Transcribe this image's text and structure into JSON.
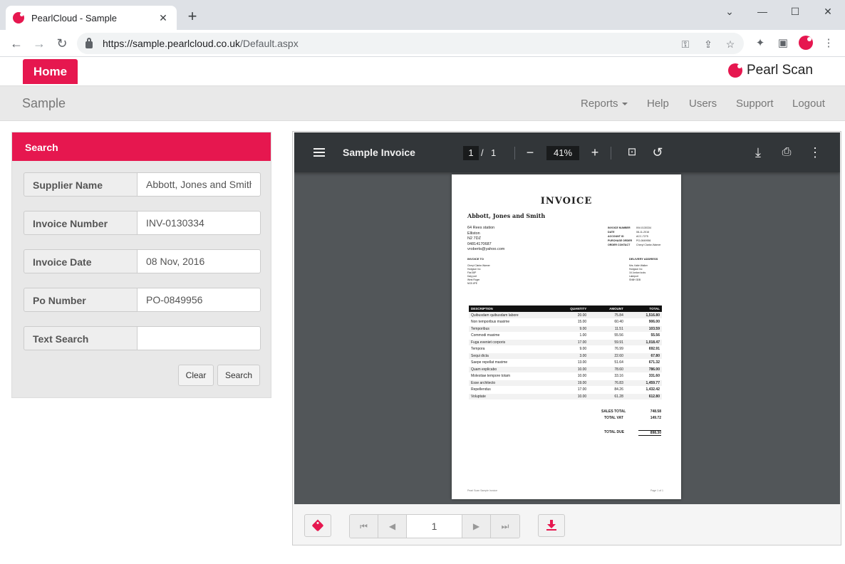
{
  "browser": {
    "tab_title": "PearlCloud - Sample",
    "url_host": "https://sample.pearlcloud.co.uk",
    "url_path": "/Default.aspx"
  },
  "header": {
    "home_label": "Home",
    "brand_name": "Pearl Scan",
    "site_title": "Sample",
    "nav": {
      "reports": "Reports",
      "help": "Help",
      "users": "Users",
      "support": "Support",
      "logout": "Logout"
    }
  },
  "search": {
    "title": "Search",
    "fields": {
      "supplier_name": {
        "label": "Supplier Name",
        "value": "Abbott, Jones and Smith"
      },
      "invoice_number": {
        "label": "Invoice Number",
        "value": "INV-0130334"
      },
      "invoice_date": {
        "label": "Invoice Date",
        "value": "08 Nov, 2016"
      },
      "po_number": {
        "label": "Po Number",
        "value": "PO-0849956"
      },
      "text_search": {
        "label": "Text Search",
        "value": ""
      }
    },
    "clear_label": "Clear",
    "search_label": "Search"
  },
  "viewer": {
    "title": "Sample Invoice",
    "current_page": "1",
    "page_separator": "/",
    "total_pages": "1",
    "zoom": "41%"
  },
  "invoice": {
    "heading": "INVOICE",
    "company": "Abbott, Jones and Smith",
    "address": [
      "64 Rees station",
      "Elliston",
      "N2 7DZ",
      "04814170687",
      "vroberts@yahoo.com"
    ],
    "meta": [
      {
        "k": "INVOICE NUMBER",
        "v": "INV-0130334"
      },
      {
        "k": "DATE",
        "v": "08-11-2016"
      },
      {
        "k": "ACCOUNT ID",
        "v": "ACC-7275"
      },
      {
        "k": "PURCHASE ORDER",
        "v": "PO-0849956"
      },
      {
        "k": "ORDER CONTACT",
        "v": "Cheryl Clarke-Warner"
      }
    ],
    "invoice_to_label": "INVOICE TO",
    "invoice_to": [
      "Cheryl Clarke-Warner",
      "Hodgson Inc",
      "Flat 38P",
      "Daly port",
      "West Roger",
      "NG5 4PE"
    ],
    "delivery_label": "DELIVERY ADDRESS",
    "delivery": [
      "Mrs. Katie Walker",
      "Hodgson Inc",
      "16 Jordan locks",
      "Lakeport",
      "SN6H 3DB"
    ],
    "columns": [
      "DESCRIPTION",
      "QUANTITY",
      "AMOUNT",
      "TOTAL"
    ],
    "rows": [
      [
        "Quibusdam quibusdam labore",
        "20.00",
        "75.84",
        "1,516.80"
      ],
      [
        "Non temporibus maxime",
        "15.00",
        "60.40",
        "906.00"
      ],
      [
        "Temporibus",
        "9.00",
        "11.51",
        "103.59"
      ],
      [
        "Commodi maxime",
        "1.00",
        "55.56",
        "55.56"
      ],
      [
        "Fuga eveniet corporis",
        "17.00",
        "59.91",
        "1,018.47"
      ],
      [
        "Tempora",
        "9.00",
        "76.99",
        "692.91"
      ],
      [
        "Sequi dicta",
        "3.00",
        "22.60",
        "67.80"
      ],
      [
        "Saepe repellat maxime",
        "13.00",
        "51.64",
        "671.32"
      ],
      [
        "Quam explicabo",
        "10.00",
        "78.60",
        "786.00"
      ],
      [
        "Molestiae tempore totam",
        "10.00",
        "33.16",
        "331.60"
      ],
      [
        "Esse architecto",
        "19.00",
        "76.83",
        "1,459.77"
      ],
      [
        "Repellendus",
        "17.00",
        "84.26",
        "1,432.42"
      ],
      [
        "Voluptate",
        "10.00",
        "61.28",
        "612.80"
      ]
    ],
    "sales_total_label": "SALES TOTAL",
    "sales_total": "748.58",
    "total_vat_label": "TOTAL VAT",
    "total_vat": "149.72",
    "total_due_label": "TOTAL DUE",
    "total_due": "898.30",
    "footer_left": "Pearl Scan Sample Invoice",
    "footer_right": "Page 1 of 1"
  },
  "pager": {
    "page": "1"
  },
  "colors": {
    "accent": "#e6174f",
    "viewer_bg": "#525659",
    "viewer_toolbar": "#323639"
  },
  "icons": [
    "close-icon",
    "plus-icon",
    "back-icon",
    "forward-icon",
    "reload-icon",
    "lock-icon",
    "key-icon",
    "share-icon",
    "star-icon",
    "puzzle-icon",
    "sidepanel-icon",
    "menu-icon",
    "hamburger-icon",
    "fit-page-icon",
    "rotate-icon",
    "download-icon",
    "print-icon",
    "more-vert-icon",
    "tag-icon",
    "first-page-icon",
    "prev-page-icon",
    "next-page-icon",
    "last-page-icon"
  ]
}
